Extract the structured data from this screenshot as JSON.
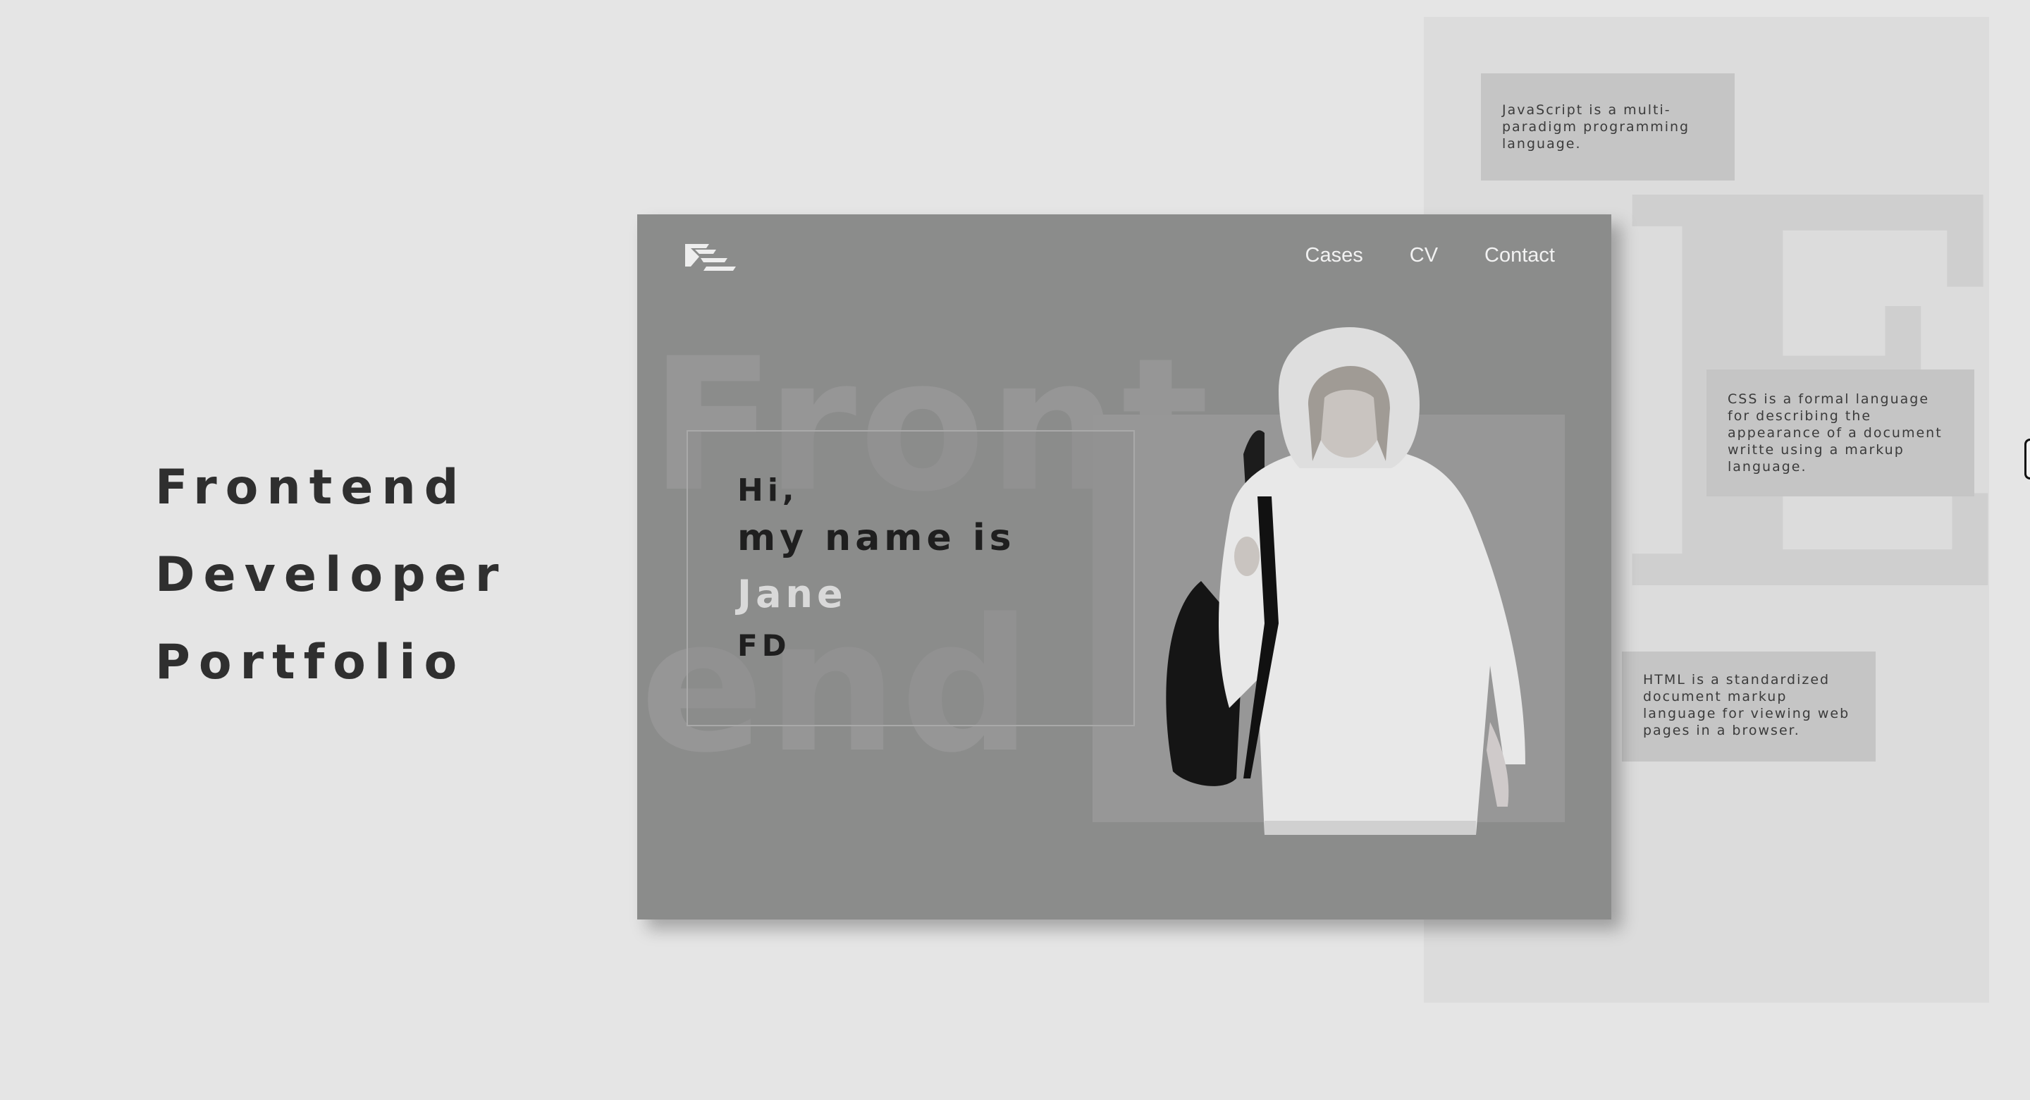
{
  "headline": {
    "lines": [
      "Frontend",
      "Developer",
      "Portfolio"
    ]
  },
  "notes": {
    "js": "JavaScript is a multi-paradigm programming language.",
    "css": "CSS is a formal language for describing the appearance of a document writte using a markup language.",
    "html": "HTML is a standardized document markup language for viewing web pages in a browser."
  },
  "card": {
    "nav": [
      "Cases",
      "CV",
      "Contact"
    ],
    "ghost_text": [
      "Front",
      "end"
    ],
    "intro": {
      "greeting": "Hi,",
      "name_is": "my name is",
      "name": "Jane",
      "role": "FD"
    }
  },
  "background_letter": "E",
  "colors": {
    "page_bg": "#e5e5e5",
    "card_bg": "#8b8c8b",
    "note_bg": "#c5c5c5",
    "text_dark": "#2f2f2f",
    "accent_light": "#d9d9d9"
  },
  "icons": {
    "logo": "fe-logo-icon",
    "edge": "scroll-handle-icon"
  }
}
